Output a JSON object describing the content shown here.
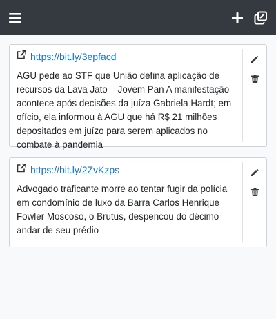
{
  "navbar": {
    "menu_icon": "hamburger-menu-icon",
    "add_icon": "plus-icon",
    "copy_icon": "copy-icon"
  },
  "items": [
    {
      "url": "https://bit.ly/3epfacd",
      "text": "AGU pede ao STF que União defina aplicação de recursos da Lava Jato – Jovem Pan A manifestação acontece após decisões da juíza Gabriela Hardt; em ofício, ela informou à AGU que há R$ 21 milhões depositados em juízo para serem aplicados no combate à pandemia"
    },
    {
      "url": "https://bit.ly/2ZvKzps",
      "text": "Advogado traficante morre ao tentar fugir da polícia em condomínio de luxo da Barra Carlos Henrique Fowler Moscoso, o Brutus, despencou do décimo andar de seu prédio"
    }
  ],
  "colors": {
    "navbar": "#343a40",
    "link": "#1a73c8"
  }
}
